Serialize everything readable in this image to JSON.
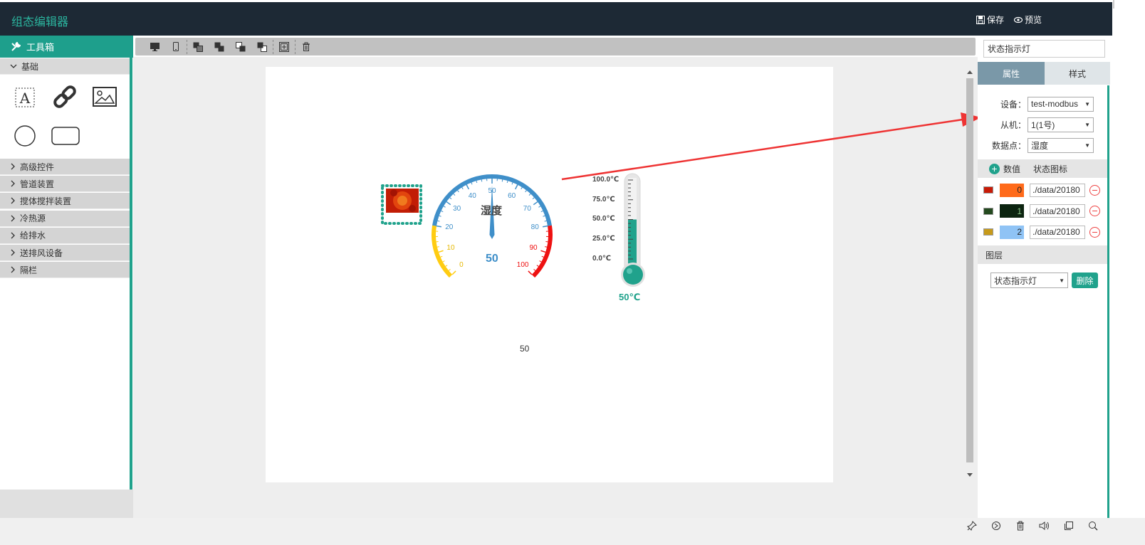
{
  "app": {
    "title": "组态编辑器"
  },
  "header": {
    "save_label": "保存",
    "preview_label": "预览"
  },
  "toolbox": {
    "title": "工具箱",
    "basic_section": "基础",
    "basic_tools": [
      "text-icon",
      "link-icon",
      "image-icon",
      "circle-icon",
      "rectangle-icon"
    ],
    "categories": [
      "高级控件",
      "管道装置",
      "搅体搅拌装置",
      "冷热源",
      "给排水",
      "送排风设备",
      "隔栏"
    ]
  },
  "toolbar": {
    "buttons": [
      "desktop-icon",
      "mobile-icon",
      "bring-forward-icon",
      "bring-to-front-icon",
      "send-backward-icon",
      "send-to-back-icon",
      "group-icon",
      "delete-icon"
    ]
  },
  "canvas": {
    "gauge": {
      "title": "湿度",
      "value": "50",
      "ticks": [
        "0",
        "10",
        "20",
        "30",
        "40",
        "50",
        "60",
        "70",
        "80",
        "90",
        "100"
      ]
    },
    "thermometer": {
      "scale": [
        "100.0℃",
        "75.0℃",
        "50.0℃",
        "25.0℃",
        "0.0℃"
      ],
      "value_label": "50℃",
      "level": 0.5
    },
    "text_value": "50"
  },
  "properties": {
    "component_name": "状态指示灯",
    "tab_properties": "属性",
    "tab_style": "样式",
    "device_label": "设备：",
    "device_value": "test-modbus",
    "slave_label": "从机：",
    "slave_value": "1(1号)",
    "point_label": "数据点：",
    "point_value": "湿度",
    "col_value": "数值",
    "col_icon": "状态图标",
    "states": [
      {
        "value": "0",
        "path": "./data/20180",
        "color": "#ff6a1a"
      },
      {
        "value": "1",
        "path": "./data/20180",
        "color": "#0c2410"
      },
      {
        "value": "2",
        "path": "./data/20180",
        "color": "#8fc3f5"
      }
    ],
    "layer_section": "图层",
    "layer_select": "状态指示灯",
    "delete_label": "删除"
  },
  "colors": {
    "header_bg": "#1d2935",
    "accent": "#20a28c",
    "gauge_blue": "#3f8fc9",
    "gauge_yellow": "#ffcc11",
    "gauge_red": "#ee1111"
  }
}
